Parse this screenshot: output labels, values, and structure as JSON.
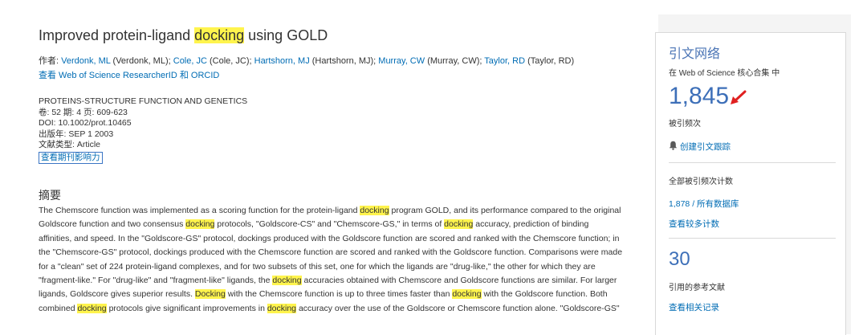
{
  "record": {
    "title_parts": [
      {
        "text": "Improved protein-ligand ",
        "hl": false
      },
      {
        "text": "docking",
        "hl": true
      },
      {
        "text": " using GOLD",
        "hl": false
      }
    ],
    "authors_label": "作者: ",
    "authors": [
      {
        "link": "Verdonk, ML",
        "full": " (Verdonk, ML); "
      },
      {
        "link": "Cole, JC",
        "full": " (Cole, JC); "
      },
      {
        "link": "Hartshorn, MJ",
        "full": " (Hartshorn, MJ); "
      },
      {
        "link": "Murray, CW",
        "full": " (Murray, CW); "
      },
      {
        "link": "Taylor, RD",
        "full": " (Taylor, RD)"
      }
    ],
    "researcher_id_link": "查看 Web of Science ResearcherID 和 ORCID",
    "journal": "PROTEINS-STRUCTURE FUNCTION AND GENETICS",
    "volume_line": "卷: 52  期: 4  页: 609-623",
    "doi_line": "DOI: 10.1002/prot.10465",
    "pub_date_line": "出版年: SEP 1 2003",
    "doc_type_line": "文献类型: Article",
    "impact_link": "查看期刊影响力",
    "abstract_heading": "摘要",
    "abstract_lines": [
      [
        {
          "t": "The Chemscore function was implemented as a scoring function for the protein-ligand ",
          "h": false
        },
        {
          "t": "docking",
          "h": true
        },
        {
          "t": " program GOLD, and its performance compared to the original",
          "h": false
        }
      ],
      [
        {
          "t": "Goldscore function and two consensus ",
          "h": false
        },
        {
          "t": "docking",
          "h": true
        },
        {
          "t": " protocols, \"Goldscore-CS\" and \"Chemscore-GS,\" in terms of ",
          "h": false
        },
        {
          "t": "docking",
          "h": true
        },
        {
          "t": " accuracy, prediction of binding",
          "h": false
        }
      ],
      [
        {
          "t": "affinities, and speed. In the \"Goldscore-GS\" protocol, dockings produced with the Goldscore function are scored and ranked with the Chemscore function; in",
          "h": false
        }
      ],
      [
        {
          "t": "the \"Chemscore-GS\" protocol, dockings produced with the Chemscore function are scored and ranked with the Goldscore function. Comparisons were made",
          "h": false
        }
      ],
      [
        {
          "t": "for a \"clean\" set of 224 protein-ligand complexes, and for two subsets of this set, one for which the ligands are \"drug-like,\" the other for which they are",
          "h": false
        }
      ],
      [
        {
          "t": "\"fragment-like.\" For \"drug-like\" and \"fragment-like\" ligands, the ",
          "h": false
        },
        {
          "t": "docking",
          "h": true
        },
        {
          "t": " accuracies obtained with Chemscore and Goldscore functions are similar. For larger",
          "h": false
        }
      ],
      [
        {
          "t": "ligands, Goldscore gives superior results. ",
          "h": false
        },
        {
          "t": "Docking",
          "h": true
        },
        {
          "t": " with the Chemscore function is up to three times faster than ",
          "h": false
        },
        {
          "t": "docking",
          "h": true
        },
        {
          "t": " with the Goldscore function. Both",
          "h": false
        }
      ],
      [
        {
          "t": "combined ",
          "h": false
        },
        {
          "t": "docking",
          "h": true
        },
        {
          "t": " protocols give significant improvements in ",
          "h": false
        },
        {
          "t": "docking",
          "h": true
        },
        {
          "t": " accuracy over the use of the Goldscore or Chemscore function alone. \"Goldscore-GS\"",
          "h": false
        }
      ]
    ]
  },
  "sidebar": {
    "title": "引文网络",
    "scope": "在 Web of Science 核心合集 中",
    "times_cited": "1,845",
    "times_cited_label": "被引频次",
    "create_alert": "创建引文跟踪",
    "all_counts_label": "全部被引频次计数",
    "all_db": "1,878 / 所有数据库",
    "view_more": "查看较多计数",
    "ref_count": "30",
    "ref_label": "引用的参考文献",
    "view_related": "查看相关记录",
    "accent_color": "#3d6fb8",
    "link_color": "#006cb4",
    "highlight_color": "#fff44d"
  }
}
